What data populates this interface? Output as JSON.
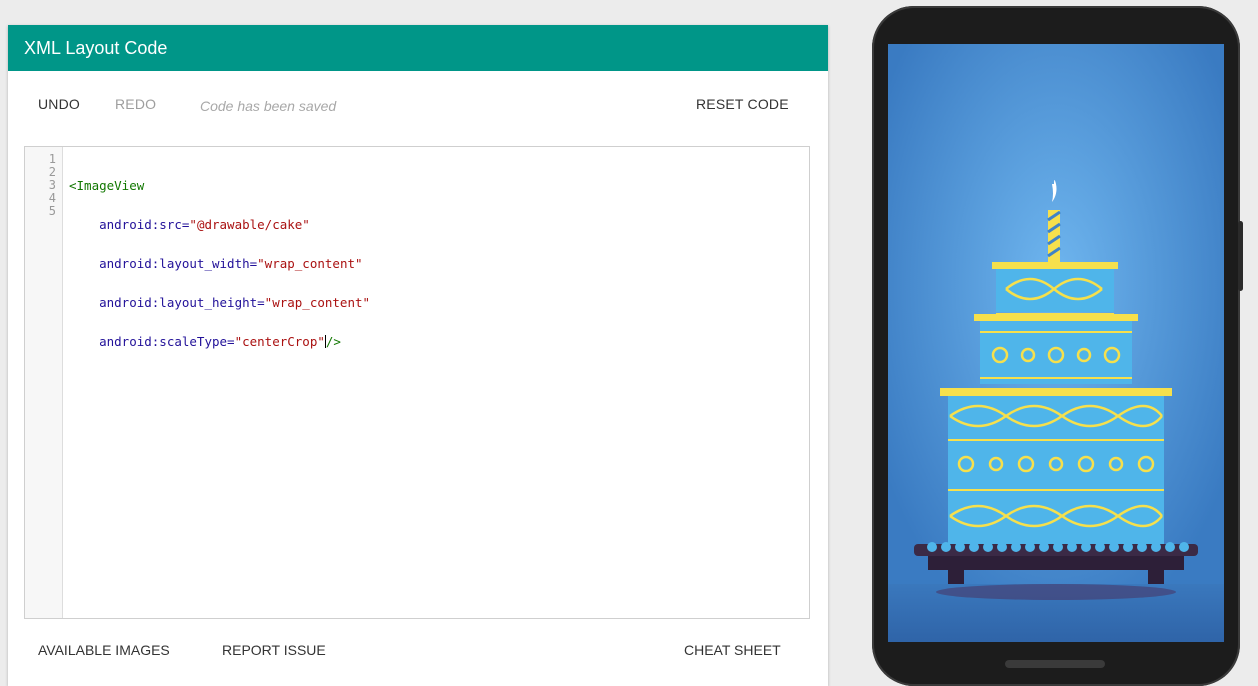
{
  "panel": {
    "title": "XML Layout Code"
  },
  "toolbar": {
    "undo": "UNDO",
    "redo": "REDO",
    "status": "Code has been saved",
    "reset": "RESET CODE"
  },
  "editor": {
    "line_numbers": [
      "1",
      "2",
      "3",
      "4",
      "5"
    ],
    "lines": {
      "l1_tag": "<ImageView",
      "l2_attr": "    android:src=",
      "l2_val": "\"@drawable/cake\"",
      "l3_attr": "    android:layout_width=",
      "l3_val": "\"wrap_content\"",
      "l4_attr": "    android:layout_height=",
      "l4_val": "\"wrap_content\"",
      "l5_attr": "    android:scaleType=",
      "l5_val": "\"centerCrop\"",
      "l5_close": "/>"
    }
  },
  "footer": {
    "available_images": "AVAILABLE IMAGES",
    "report_issue": "REPORT ISSUE",
    "cheat_sheet": "CHEAT SHEET"
  },
  "colors": {
    "header": "#009688",
    "screen_background": "#3f83c7",
    "cake_blue": "#4fb5ea",
    "cake_yellow": "#f6e04c",
    "plate": "#3b2a46"
  },
  "preview": {
    "image_description_icon": "birthday-cake-icon"
  }
}
